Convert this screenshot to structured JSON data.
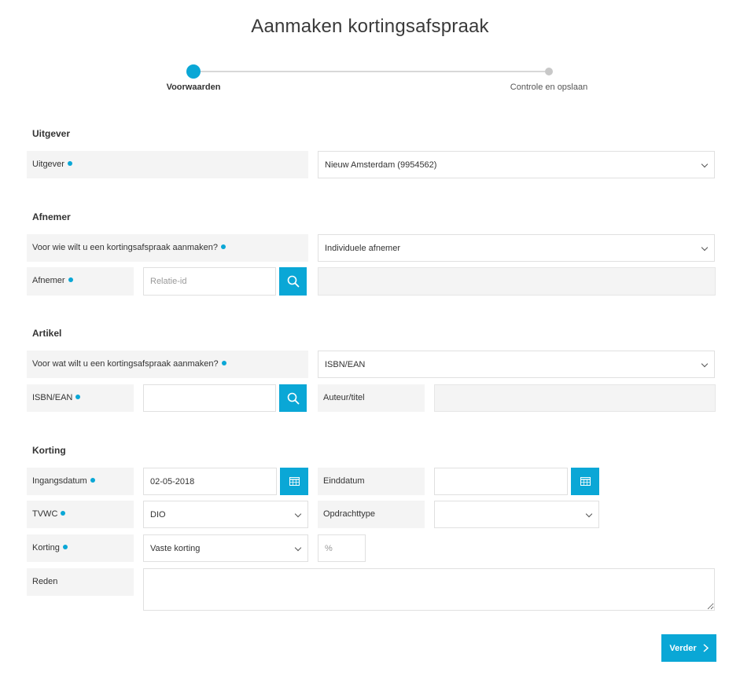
{
  "page": {
    "title": "Aanmaken kortingsafspraak"
  },
  "steps": [
    {
      "label": "Voorwaarden",
      "state": "active"
    },
    {
      "label": "Controle en opslaan",
      "state": "inactive"
    }
  ],
  "uitgever": {
    "section": "Uitgever",
    "label": "Uitgever",
    "value": "Nieuw Amsterdam (9954562)"
  },
  "afnemer": {
    "section": "Afnemer",
    "voor_wie_label": "Voor wie wilt u een kortingsafspraak aanmaken?",
    "voor_wie_value": "Individuele afnemer",
    "afnemer_label": "Afnemer",
    "relatie_placeholder": "Relatie-id",
    "relatie_value": "",
    "name_value": ""
  },
  "artikel": {
    "section": "Artikel",
    "voor_wat_label": "Voor wat wilt u een kortingsafspraak aanmaken?",
    "voor_wat_value": "ISBN/EAN",
    "isbn_label": "ISBN/EAN",
    "isbn_value": "",
    "auteur_label": "Auteur/titel",
    "auteur_value": ""
  },
  "korting": {
    "section": "Korting",
    "ingangsdatum_label": "Ingangsdatum",
    "ingangsdatum_value": "02-05-2018",
    "einddatum_label": "Einddatum",
    "einddatum_value": "",
    "tvwc_label": "TVWC",
    "tvwc_value": "DIO",
    "opdrachttype_label": "Opdrachttype",
    "opdrachttype_value": "",
    "korting_label": "Korting",
    "korting_type_value": "Vaste korting",
    "percent_placeholder": "%",
    "reden_label": "Reden",
    "reden_value": ""
  },
  "actions": {
    "verder_label": "Verder"
  },
  "colors": {
    "accent": "#0aa7d6",
    "label_bg": "#f4f4f4"
  },
  "icons": {
    "search": "search-icon",
    "calendar": "calendar-icon",
    "chevron": "chevron-down-icon",
    "next": "chevron-right-icon"
  }
}
